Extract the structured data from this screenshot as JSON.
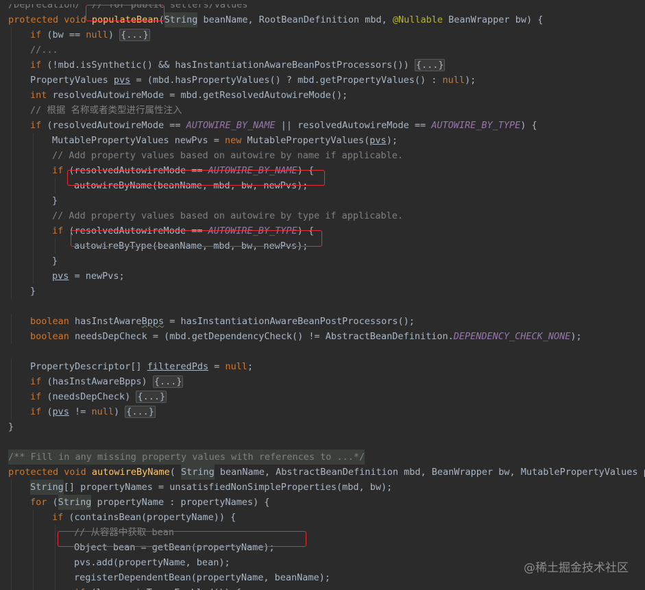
{
  "lines": [
    {
      "indent": 0,
      "tokens": [
        [
          "com",
          "/Deprecation/  // for public setters/values"
        ]
      ]
    },
    {
      "indent": 0,
      "tokens": [
        [
          "kw",
          "protected void "
        ],
        [
          "fn",
          "populateBean"
        ],
        [
          "id",
          "("
        ],
        [
          "hl",
          "String"
        ],
        [
          "id",
          " beanName, RootBeanDefinition mbd, "
        ],
        [
          "ann",
          "@Nullable"
        ],
        [
          "id",
          " BeanWrapper bw) {"
        ]
      ]
    },
    {
      "indent": 1,
      "tokens": [
        [
          "kw",
          "if "
        ],
        [
          "id",
          "(bw == "
        ],
        [
          "kw",
          "null"
        ],
        [
          "id",
          ") "
        ],
        [
          "fold",
          "{...}"
        ]
      ]
    },
    {
      "indent": 1,
      "tokens": [
        [
          "com",
          "//..."
        ]
      ]
    },
    {
      "indent": 1,
      "tokens": [
        [
          "kw",
          "if "
        ],
        [
          "id",
          "(!mbd.isSynthetic() && hasInstantiationAwareBeanPostProcessors()) "
        ],
        [
          "fold",
          "{...}"
        ]
      ]
    },
    {
      "indent": 1,
      "tokens": [
        [
          "id",
          "PropertyValues "
        ],
        [
          "ul",
          "pvs"
        ],
        [
          "id",
          " = (mbd.hasPropertyValues() ? mbd.getPropertyValues() : "
        ],
        [
          "kw",
          "null"
        ],
        [
          "id",
          ");"
        ]
      ]
    },
    {
      "indent": 1,
      "tokens": [
        [
          "kw",
          "int "
        ],
        [
          "id",
          "resolvedAutowireMode = mbd.getResolvedAutowireMode();"
        ]
      ]
    },
    {
      "indent": 1,
      "tokens": [
        [
          "com",
          "// 根据 名称或者类型进行属性注入"
        ]
      ]
    },
    {
      "indent": 1,
      "tokens": [
        [
          "kw",
          "if "
        ],
        [
          "id",
          "(resolvedAutowireMode == "
        ],
        [
          "static",
          "AUTOWIRE_BY_NAME"
        ],
        [
          "id",
          " || resolvedAutowireMode == "
        ],
        [
          "static",
          "AUTOWIRE_BY_TYPE"
        ],
        [
          "id",
          ") {"
        ]
      ]
    },
    {
      "indent": 2,
      "tokens": [
        [
          "id",
          "MutablePropertyValues newPvs = "
        ],
        [
          "kw",
          "new "
        ],
        [
          "id",
          "MutablePropertyValues("
        ],
        [
          "ul",
          "pvs"
        ],
        [
          "id",
          ");"
        ]
      ]
    },
    {
      "indent": 2,
      "tokens": [
        [
          "com",
          "// Add property values based on autowire by name if applicable."
        ]
      ]
    },
    {
      "indent": 2,
      "tokens": [
        [
          "kw",
          "if "
        ],
        [
          "id",
          "(resolvedAutowireMode == "
        ],
        [
          "static",
          "AUTOWIRE_BY_NAME"
        ],
        [
          "id",
          ") {"
        ]
      ]
    },
    {
      "indent": 3,
      "tokens": [
        [
          "id",
          "autowireByName(beanName, mbd, bw, newPvs);"
        ]
      ]
    },
    {
      "indent": 2,
      "tokens": [
        [
          "id",
          "}"
        ]
      ]
    },
    {
      "indent": 2,
      "tokens": [
        [
          "com",
          "// Add property values based on autowire by type if applicable."
        ]
      ]
    },
    {
      "indent": 2,
      "tokens": [
        [
          "kw",
          "if "
        ],
        [
          "id",
          "(resolvedAutowireMode == "
        ],
        [
          "static",
          "AUTOWIRE_BY_TYPE"
        ],
        [
          "id",
          ") {"
        ]
      ]
    },
    {
      "indent": 3,
      "tokens": [
        [
          "id",
          "autowireByType(beanName, mbd, bw, newPvs);"
        ]
      ]
    },
    {
      "indent": 2,
      "tokens": [
        [
          "id",
          "}"
        ]
      ]
    },
    {
      "indent": 2,
      "tokens": [
        [
          "ul",
          "pvs"
        ],
        [
          "id",
          " = newPvs;"
        ]
      ]
    },
    {
      "indent": 1,
      "tokens": [
        [
          "id",
          "}"
        ]
      ]
    },
    {
      "indent": 0,
      "tokens": []
    },
    {
      "indent": 1,
      "tokens": [
        [
          "kw",
          "boolean "
        ],
        [
          "id",
          "hasInstAware"
        ],
        [
          "warn",
          "Bpps"
        ],
        [
          "id",
          " = hasInstantiationAwareBeanPostProcessors();"
        ]
      ]
    },
    {
      "indent": 1,
      "tokens": [
        [
          "kw",
          "boolean "
        ],
        [
          "id",
          "needsDepCheck = (mbd.getDependencyCheck() != AbstractBeanDefinition."
        ],
        [
          "static",
          "DEPENDENCY_CHECK_NONE"
        ],
        [
          "id",
          ");"
        ]
      ]
    },
    {
      "indent": 0,
      "tokens": []
    },
    {
      "indent": 1,
      "tokens": [
        [
          "id",
          "PropertyDescriptor[] "
        ],
        [
          "ul",
          "filteredPds"
        ],
        [
          "id",
          " = "
        ],
        [
          "kw",
          "null"
        ],
        [
          "id",
          ";"
        ]
      ]
    },
    {
      "indent": 1,
      "tokens": [
        [
          "kw",
          "if "
        ],
        [
          "id",
          "(hasInstAwareBpps) "
        ],
        [
          "fold",
          "{...}"
        ]
      ]
    },
    {
      "indent": 1,
      "tokens": [
        [
          "kw",
          "if "
        ],
        [
          "id",
          "(needsDepCheck) "
        ],
        [
          "fold",
          "{...}"
        ]
      ]
    },
    {
      "indent": 1,
      "tokens": [
        [
          "kw",
          "if "
        ],
        [
          "id",
          "("
        ],
        [
          "ul",
          "pvs"
        ],
        [
          "id",
          " != "
        ],
        [
          "kw",
          "null"
        ],
        [
          "id",
          ") "
        ],
        [
          "fold",
          "{...}"
        ]
      ]
    },
    {
      "indent": 0,
      "tokens": [
        [
          "id",
          "}"
        ]
      ]
    },
    {
      "indent": 0,
      "tokens": []
    },
    {
      "indent": 0,
      "tokens": [
        [
          "hlcom",
          "/** Fill in any missing property values with references to ...*/"
        ]
      ]
    },
    {
      "indent": 0,
      "tokens": [
        [
          "kw",
          "protected void "
        ],
        [
          "fn",
          "autowireByName"
        ],
        [
          "id",
          "( "
        ],
        [
          "hl",
          "String"
        ],
        [
          "id",
          " beanName, AbstractBeanDefinition mbd, BeanWrapper bw, MutablePropertyValues pvs"
        ]
      ]
    },
    {
      "indent": 1,
      "tokens": [
        [
          "hl",
          "String"
        ],
        [
          "id",
          "[] propertyNames = unsatisfiedNonSimpleProperties(mbd, bw);"
        ]
      ]
    },
    {
      "indent": 1,
      "tokens": [
        [
          "kw",
          "for "
        ],
        [
          "id",
          "("
        ],
        [
          "hl",
          "String"
        ],
        [
          "id",
          " propertyName : propertyNames) {"
        ]
      ]
    },
    {
      "indent": 2,
      "tokens": [
        [
          "kw",
          "if "
        ],
        [
          "id",
          "(containsBean(propertyName)) {"
        ]
      ]
    },
    {
      "indent": 3,
      "tokens": [
        [
          "com",
          "// 从容器中获取 bean"
        ]
      ]
    },
    {
      "indent": 3,
      "tokens": [
        [
          "id",
          "Object bean = getBean(propertyName);"
        ]
      ]
    },
    {
      "indent": 3,
      "tokens": [
        [
          "id",
          "pvs.add(propertyName, bean);"
        ]
      ]
    },
    {
      "indent": 3,
      "tokens": [
        [
          "id",
          "registerDependentBean(propertyName, beanName);"
        ]
      ]
    },
    {
      "indent": 3,
      "tokens": [
        [
          "kw",
          "if "
        ],
        [
          "id",
          "(logger.isTraceEnabled()) {"
        ]
      ]
    }
  ],
  "colors": {
    "background": "#2b2b2b",
    "keyword": "#cc7832",
    "method": "#ffc66d",
    "identifier": "#a9b7c6",
    "annotation": "#bbb529",
    "comment": "#808080",
    "static_field": "#9876aa",
    "highlight_box": "#e0313b"
  },
  "watermark": "@稀土掘金技术社区"
}
